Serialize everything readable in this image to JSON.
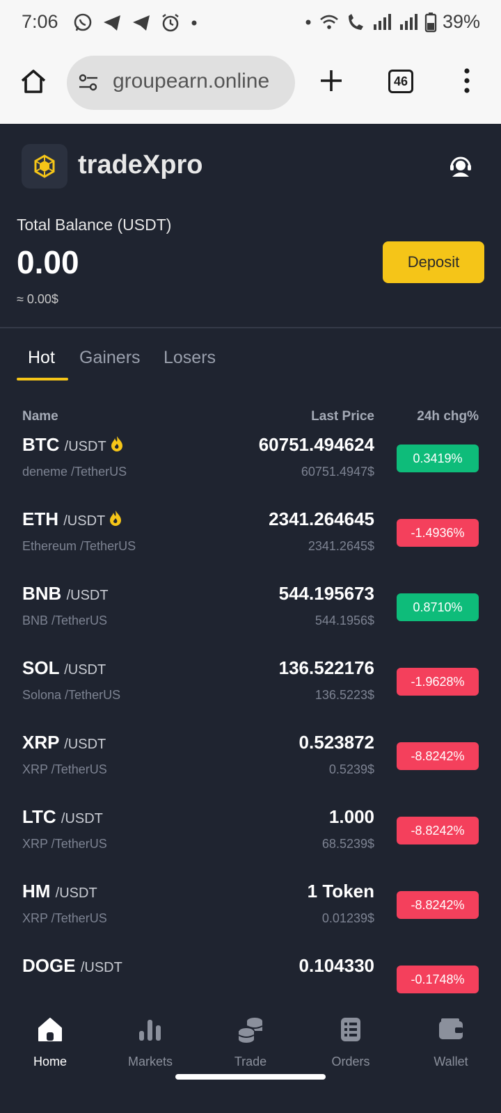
{
  "status_bar": {
    "time": "7:06",
    "battery": "39%"
  },
  "browser": {
    "url": "groupearn.online",
    "tab_count": "46"
  },
  "app": {
    "brand": "tradeXpro",
    "balance_label": "Total Balance (USDT)",
    "balance_value": "0.00",
    "balance_usd": "≈ 0.00$",
    "deposit_label": "Deposit"
  },
  "tabs": [
    {
      "label": "Hot",
      "active": true
    },
    {
      "label": "Gainers",
      "active": false
    },
    {
      "label": "Losers",
      "active": false
    }
  ],
  "columns": {
    "name": "Name",
    "price": "Last Price",
    "change": "24h chg%"
  },
  "markets": [
    {
      "symbol": "BTC",
      "pair": "/USDT",
      "hot": true,
      "sub": "deneme /TetherUS",
      "price": "60751.494624",
      "price_usd": "60751.4947$",
      "change": "0.3419%",
      "dir": "up"
    },
    {
      "symbol": "ETH",
      "pair": "/USDT",
      "hot": true,
      "sub": "Ethereum /TetherUS",
      "price": "2341.264645",
      "price_usd": "2341.2645$",
      "change": "-1.4936%",
      "dir": "down"
    },
    {
      "symbol": "BNB",
      "pair": "/USDT",
      "hot": false,
      "sub": "BNB /TetherUS",
      "price": "544.195673",
      "price_usd": "544.1956$",
      "change": "0.8710%",
      "dir": "up"
    },
    {
      "symbol": "SOL",
      "pair": "/USDT",
      "hot": false,
      "sub": "Solona /TetherUS",
      "price": "136.522176",
      "price_usd": "136.5223$",
      "change": "-1.9628%",
      "dir": "down"
    },
    {
      "symbol": "XRP",
      "pair": "/USDT",
      "hot": false,
      "sub": "XRP /TetherUS",
      "price": "0.523872",
      "price_usd": "0.5239$",
      "change": "-8.8242%",
      "dir": "down"
    },
    {
      "symbol": "LTC",
      "pair": "/USDT",
      "hot": false,
      "sub": "XRP /TetherUS",
      "price": "1.000",
      "price_usd": "68.5239$",
      "change": "-8.8242%",
      "dir": "down"
    },
    {
      "symbol": "HM",
      "pair": "/USDT",
      "hot": false,
      "sub": "XRP /TetherUS",
      "price": "1 Token",
      "price_usd": "0.01239$",
      "change": "-8.8242%",
      "dir": "down"
    },
    {
      "symbol": "DOGE",
      "pair": "/USDT",
      "hot": false,
      "sub": "",
      "price": "0.104330",
      "price_usd": "",
      "change": "-0.1748%",
      "dir": "down"
    }
  ],
  "nav": [
    {
      "label": "Home",
      "icon": "home-icon",
      "active": true
    },
    {
      "label": "Markets",
      "icon": "bar-chart-icon",
      "active": false
    },
    {
      "label": "Trade",
      "icon": "coins-icon",
      "active": false
    },
    {
      "label": "Orders",
      "icon": "orders-list-icon",
      "active": false
    },
    {
      "label": "Wallet",
      "icon": "wallet-icon",
      "active": false
    }
  ],
  "colors": {
    "accent": "#f5c518",
    "up": "#0ebc7a",
    "down": "#f4405c",
    "background": "#1f2430"
  }
}
